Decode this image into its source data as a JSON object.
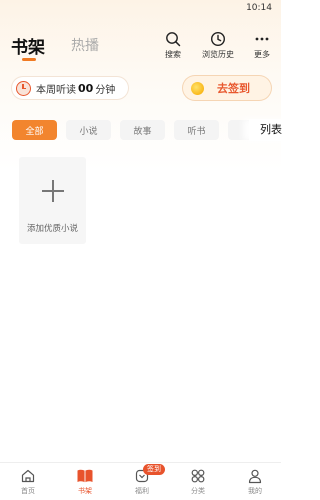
{
  "status_bar": {
    "time": "10:14"
  },
  "header": {
    "tabs": [
      {
        "label": "书架",
        "active": true
      },
      {
        "label": "热播",
        "active": false
      }
    ],
    "actions": [
      {
        "label": "搜索",
        "icon": "search-icon"
      },
      {
        "label": "浏览历史",
        "icon": "clock-icon"
      },
      {
        "label": "更多",
        "icon": "more-dots-icon"
      }
    ]
  },
  "listen_stats": {
    "prefix": "本周听读",
    "value": "00",
    "unit": "分钟"
  },
  "signin": {
    "label": "去签到",
    "icon": "coin-icon"
  },
  "filters": {
    "chips": [
      {
        "label": "全部",
        "active": true
      },
      {
        "label": "小说",
        "active": false
      },
      {
        "label": "故事",
        "active": false
      },
      {
        "label": "听书",
        "active": false
      }
    ],
    "view_toggle": "列表"
  },
  "add_card": {
    "label": "添加优质小说",
    "icon": "plus-icon"
  },
  "bottom_nav": {
    "items": [
      {
        "label": "首页",
        "icon": "home-icon",
        "active": false
      },
      {
        "label": "书架",
        "icon": "book-icon",
        "active": true
      },
      {
        "label": "福利",
        "icon": "gift-icon",
        "active": false
      },
      {
        "label": "分类",
        "icon": "grid-icon",
        "active": false
      },
      {
        "label": "我的",
        "icon": "user-icon",
        "active": false
      }
    ],
    "badge": "签到"
  },
  "colors": {
    "accent": "#f2852e",
    "nav_active": "#e8532c",
    "signin_text": "#e8582e"
  }
}
